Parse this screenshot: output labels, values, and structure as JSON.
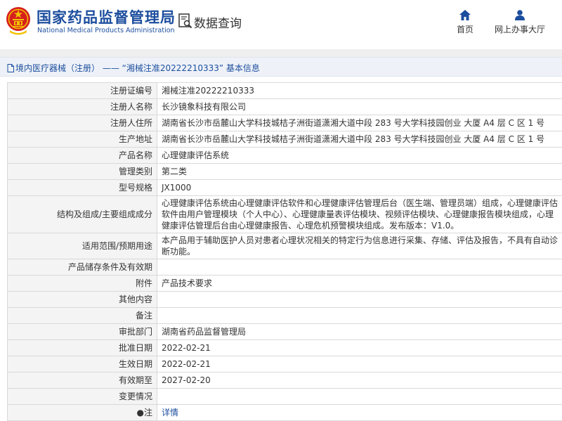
{
  "header": {
    "title_cn": "国家药品监督管理局",
    "title_en": "National Medical Products Administration",
    "section_label": "数据查询",
    "nav": [
      {
        "label": "首页",
        "icon": "home-icon"
      },
      {
        "label": "网上办事大厅",
        "icon": "user-icon"
      }
    ]
  },
  "breadcrumb": {
    "category": "境内医疗器械（注册）",
    "separator": "——",
    "item": "“湘械注准20222210333”",
    "suffix": "基本信息"
  },
  "detail": {
    "rows": [
      {
        "label": "注册证编号",
        "value": "湘械注准20222210333"
      },
      {
        "label": "注册人名称",
        "value": "长沙镜象科技有限公司"
      },
      {
        "label": "注册人住所",
        "value": "湖南省长沙市岳麓山大学科技城桔子洲街道潇湘大道中段 283 号大学科技园创业 大厦 A4 层 C 区 1 号"
      },
      {
        "label": "生产地址",
        "value": "湖南省长沙市岳麓山大学科技城桔子洲街道潇湘大道中段 283 号大学科技园创业 大厦 A4 层 C 区 1 号"
      },
      {
        "label": "产品名称",
        "value": "心理健康评估系统"
      },
      {
        "label": "管理类别",
        "value": "第二类"
      },
      {
        "label": "型号规格",
        "value": "JX1000"
      },
      {
        "label": "结构及组成/主要组成成分",
        "value": "心理健康评估系统由心理健康评估软件和心理健康评估管理后台（医生端、管理员端）组成，心理健康评估软件由用户管理模块（个人中心）、心理健康量表评估模块、视频评估模块、心理健康报告模块组成，心理健康评估管理后台由心理健康报告、心理危机预警模块组成。发布版本：V1.0。"
      },
      {
        "label": "适用范围/预期用途",
        "value": "本产品用于辅助医护人员对患者心理状况相关的特定行为信息进行采集、存储、评估及报告，不具有自动诊断功能。"
      },
      {
        "label": "产品储存条件及有效期",
        "value": ""
      },
      {
        "label": "附件",
        "value": "产品技术要求"
      },
      {
        "label": "其他内容",
        "value": ""
      },
      {
        "label": "备注",
        "value": ""
      },
      {
        "label": "审批部门",
        "value": "湖南省药品监督管理局"
      },
      {
        "label": "批准日期",
        "value": "2022-02-21"
      },
      {
        "label": "生效日期",
        "value": "2022-02-21"
      },
      {
        "label": "有效期至",
        "value": "2027-02-20"
      },
      {
        "label": "变更情况",
        "value": ""
      },
      {
        "label": "●注",
        "value": "详情"
      }
    ]
  },
  "colors": {
    "brand_blue": "#1d4e9e",
    "emblem_red": "#d6201e",
    "emblem_gold": "#f2c200",
    "label_bg": "#f4f4f4",
    "border": "#d9d9d9"
  }
}
